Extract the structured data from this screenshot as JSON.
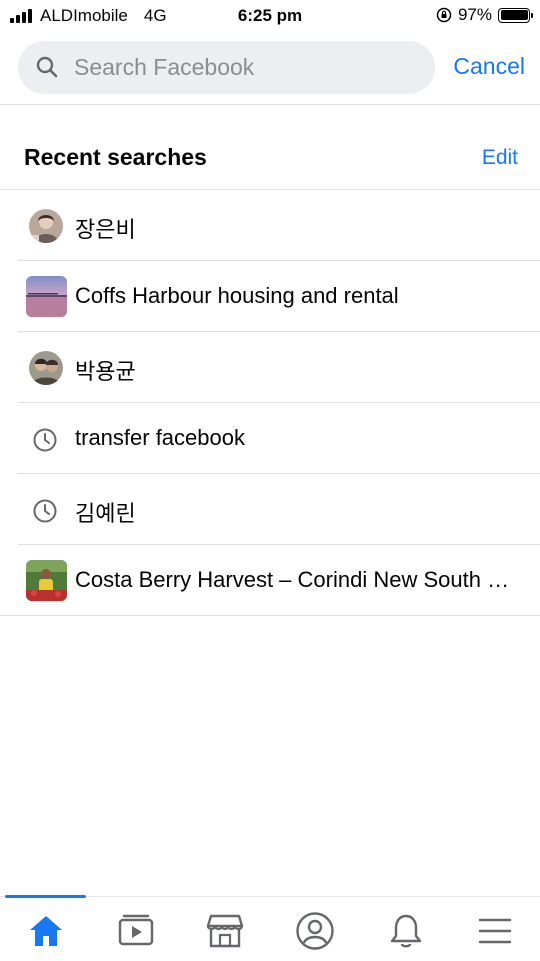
{
  "status_bar": {
    "carrier": "ALDImobile",
    "network": "4G",
    "time": "6:25 pm",
    "battery": "97%"
  },
  "search": {
    "placeholder": "Search Facebook",
    "value": "",
    "cancel_label": "Cancel"
  },
  "recent": {
    "title": "Recent searches",
    "edit_label": "Edit",
    "items": [
      {
        "label": "장은비",
        "icon": "profile-avatar"
      },
      {
        "label": "Coffs Harbour housing and rental",
        "icon": "group-thumbnail"
      },
      {
        "label": "박용균",
        "icon": "profile-avatar"
      },
      {
        "label": "transfer facebook",
        "icon": "clock-icon"
      },
      {
        "label": "김예린",
        "icon": "clock-icon"
      },
      {
        "label": "Costa Berry Harvest – Corindi New South Wales",
        "icon": "page-thumbnail"
      }
    ]
  },
  "bottom_nav": {
    "items": [
      "home-icon",
      "watch-icon",
      "marketplace-icon",
      "profile-icon",
      "notifications-icon",
      "menu-icon"
    ],
    "active": "home-icon"
  },
  "colors": {
    "accent": "#1877f2",
    "search_bg": "#eceef1",
    "placeholder": "#8a8d91",
    "divider": "#dcdfe3",
    "icon_gray": "#65676b"
  }
}
